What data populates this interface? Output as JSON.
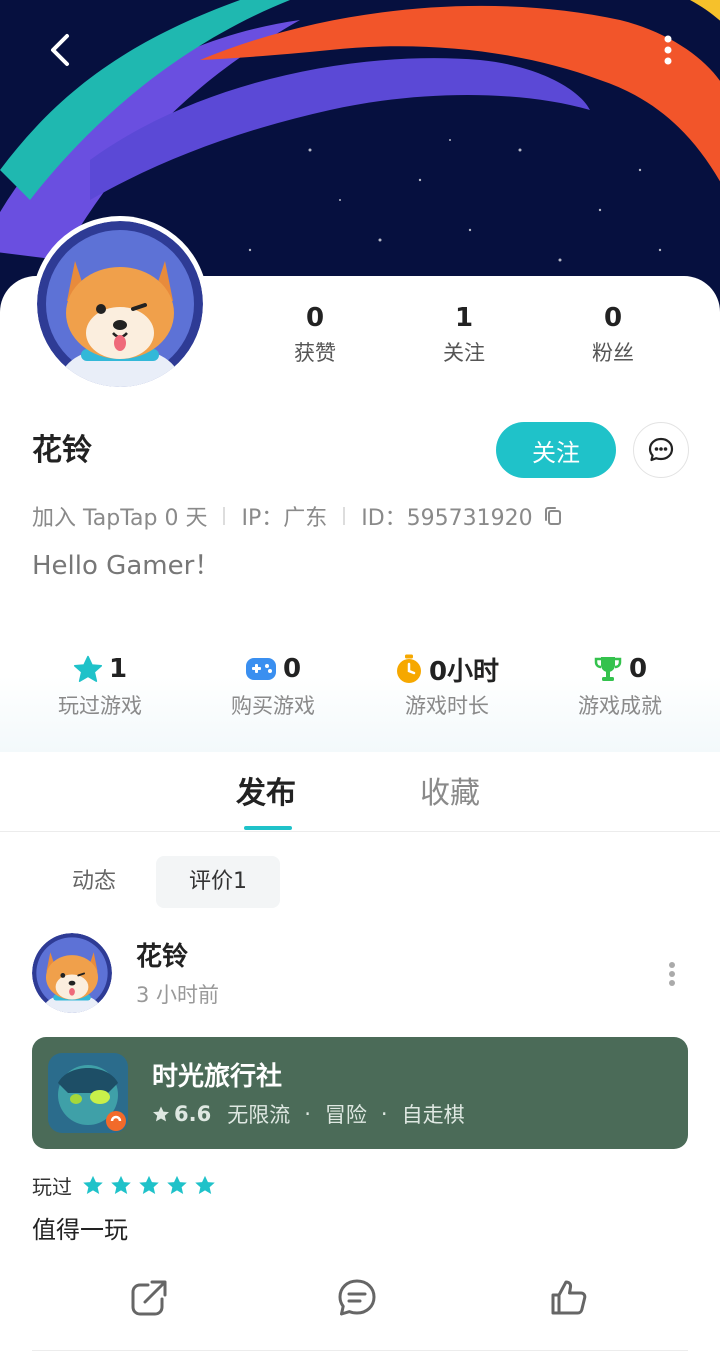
{
  "colors": {
    "accent": "#1fc2c9",
    "game_card_bg": "#4b6b58",
    "banner_bg": "#06103f"
  },
  "header": {
    "back_icon": "chevron-left-icon",
    "more_icon": "more-vertical-icon"
  },
  "profile": {
    "stats": [
      {
        "value": "0",
        "label": "获赞"
      },
      {
        "value": "1",
        "label": "关注"
      },
      {
        "value": "0",
        "label": "粉丝"
      }
    ],
    "name": "花铃",
    "follow_label": "关注",
    "join_text": "加入 TapTap 0 天",
    "ip_text": "IP：广东",
    "id_text": "ID：595731920",
    "bio": "Hello Gamer！"
  },
  "game_stats": [
    {
      "icon": "star-icon",
      "value": "1",
      "label": "玩过游戏"
    },
    {
      "icon": "gamepad-icon",
      "value": "0",
      "label": "购买游戏"
    },
    {
      "icon": "stopwatch-icon",
      "value": "0小时",
      "label": "游戏时长"
    },
    {
      "icon": "trophy-icon",
      "value": "0",
      "label": "游戏成就"
    }
  ],
  "tabs": [
    {
      "label": "发布",
      "active": true
    },
    {
      "label": "收藏",
      "active": false
    }
  ],
  "subtabs": [
    {
      "label": "动态",
      "active": false
    },
    {
      "label": "评价1",
      "active": true
    }
  ],
  "post": {
    "author": "花铃",
    "time": "3 小时前",
    "game": {
      "title": "时光旅行社",
      "rating": "6.6",
      "tags": [
        "无限流",
        "冒险",
        "自走棋"
      ],
      "dot": "·"
    },
    "played_label": "玩过",
    "stars": 5,
    "text": "值得一玩",
    "actions": [
      "share-icon",
      "comment-icon",
      "like-icon"
    ]
  }
}
